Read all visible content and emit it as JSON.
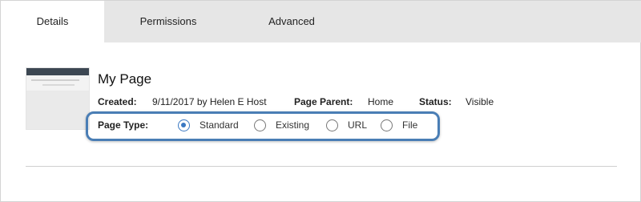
{
  "tabs": [
    {
      "label": "Details",
      "active": true
    },
    {
      "label": "Permissions",
      "active": false
    },
    {
      "label": "Advanced",
      "active": false
    }
  ],
  "page": {
    "title": "My Page",
    "created_label": "Created:",
    "created_value": "9/11/2017 by Helen E Host",
    "parent_label": "Page Parent:",
    "parent_value": "Home",
    "status_label": "Status:",
    "status_value": "Visible"
  },
  "page_type": {
    "label": "Page Type:",
    "selected": "Standard",
    "options": [
      {
        "label": "Standard",
        "checked": true
      },
      {
        "label": "Existing",
        "checked": false
      },
      {
        "label": "URL",
        "checked": false
      },
      {
        "label": "File",
        "checked": false
      }
    ]
  },
  "colors": {
    "highlight_border": "#4a7eb5",
    "radio_selected": "#3a78c2",
    "tabbar_bg": "#e6e6e6"
  }
}
